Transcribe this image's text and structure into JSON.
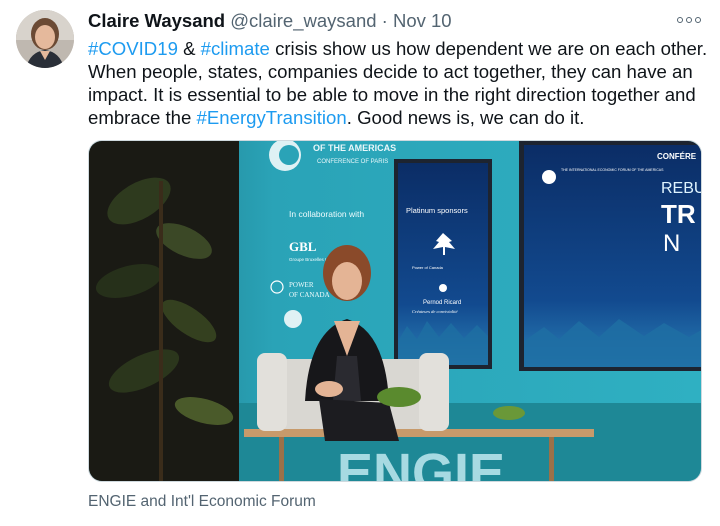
{
  "author": {
    "display_name": "Claire Waysand",
    "handle": "@claire_waysand",
    "separator": "·",
    "date": "Nov 10"
  },
  "tweet": {
    "parts": [
      {
        "text": "#COVID19",
        "link": true
      },
      {
        "text": " & ",
        "link": false
      },
      {
        "text": "#climate",
        "link": true
      },
      {
        "text": " crisis show us how dependent we are on each other. When people, states, companies decide to act together, they can have an impact. It is essential to be able to move in the right direction together and embrace the ",
        "link": false
      },
      {
        "text": "#EnergyTransition",
        "link": true
      },
      {
        "text": ". Good news is, we can do it.",
        "link": false
      }
    ]
  },
  "media": {
    "backdrop_title": "OF THE AMERICAS",
    "backdrop_subtitle": "CONFERENCE OF PARIS",
    "collab_text": "In collaboration with",
    "gbl_logo": "GBL",
    "gbl_sub": "Groupe Bruxelles Lambert",
    "power_text": "POWER",
    "power_sub": "OF CANADA",
    "screen1_title": "Platinum sponsors",
    "screen1_sponsor_a": "Power of Canada",
    "screen1_sponsor_b": "Pernod Ricard",
    "screen1_tagline": "Créateurs de convivialité",
    "screen2_org": "THE INTERNATIONAL ECONOMIC FORUM OF THE AMERICAS",
    "screen2_conf": "CONFÉRE",
    "screen2_big1": "REBU",
    "screen2_big2": "TR",
    "screen2_big3": "N",
    "engie_text": "ENGIE",
    "colors": {
      "backdrop": "#2aa3b7",
      "screen": "#0d3a78",
      "floor": "#1e8896"
    }
  },
  "caption": "ENGIE and Int'l Economic Forum",
  "colors": {
    "link": "#1d9bf0",
    "secondary": "#536471",
    "text": "#0f1419"
  },
  "icons": {
    "more": "more-horizontal-icon"
  }
}
